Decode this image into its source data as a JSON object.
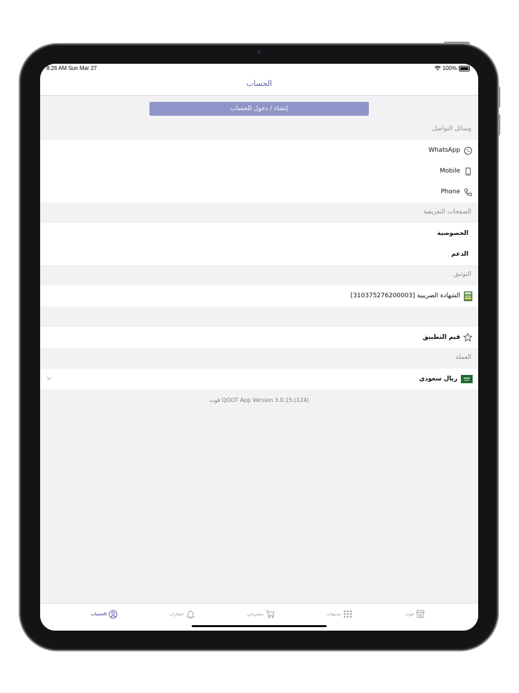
{
  "status_bar": {
    "time": "8:26 AM  Sun Mar 27",
    "battery": "100%"
  },
  "nav": {
    "title": "الحساب"
  },
  "login_button": "إنشاء / دخول للحساب",
  "sections": {
    "contact": {
      "header": "وسائل التواصل",
      "items": [
        {
          "label": "WhatsApp",
          "icon": "whatsapp-icon"
        },
        {
          "label": "Mobile",
          "icon": "mobile-icon"
        },
        {
          "label": "Phone",
          "icon": "phone-icon"
        }
      ]
    },
    "pages": {
      "header": "الصفحات التعريفية",
      "items": [
        {
          "label": "الخصوصية"
        },
        {
          "label": "الدعم"
        }
      ]
    },
    "verification": {
      "header": "التوثيق",
      "items": [
        {
          "label": "الشهادة الضريبية [310375276200003]",
          "icon": "tax-certificate-icon"
        }
      ]
    },
    "rate": {
      "label": "قيم التطبيق",
      "icon": "star-icon"
    },
    "currency": {
      "header": "العملة",
      "label": "ريال سعودي",
      "icon": "saudi-flag-icon"
    }
  },
  "version": "قوت QOOT App Version 3.0.15.(124)",
  "tabs": [
    {
      "label": "قوت",
      "icon": "store-icon",
      "active": false
    },
    {
      "label": "تصنيفات",
      "icon": "grid-icon",
      "active": false
    },
    {
      "label": "مشترياتي",
      "icon": "cart-icon",
      "active": false
    },
    {
      "label": "اشعارات",
      "icon": "bell-icon",
      "active": false
    },
    {
      "label": "الحساب",
      "icon": "account-icon",
      "active": true
    }
  ],
  "colors": {
    "accent": "#5a5fa8",
    "button": "#8f95c8",
    "background": "#f2f2f4"
  }
}
